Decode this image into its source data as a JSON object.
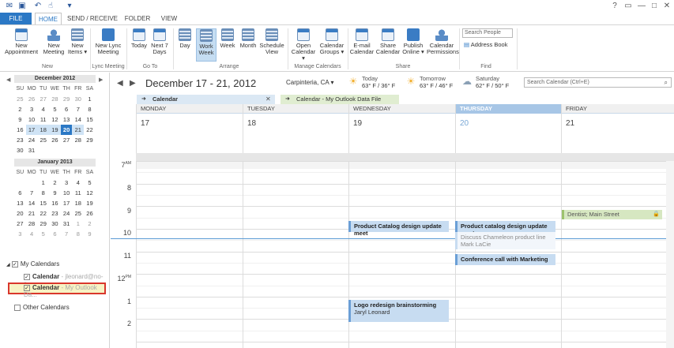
{
  "titlebar": {
    "help": "?",
    "restore": "▭",
    "minimize": "—",
    "maximize": "□",
    "close": "✕"
  },
  "tabs": {
    "file": "FILE",
    "home": "HOME",
    "send_receive": "SEND / RECEIVE",
    "folder": "FOLDER",
    "view": "VIEW"
  },
  "ribbon": {
    "new_appointment": [
      "New",
      "Appointment"
    ],
    "new_meeting": [
      "New",
      "Meeting"
    ],
    "new_items": [
      "New",
      "Items ▾"
    ],
    "new_lync_meeting": [
      "New Lync",
      "Meeting"
    ],
    "today": "Today",
    "next7": [
      "Next 7",
      "Days"
    ],
    "day": "Day",
    "work_week": [
      "Work",
      "Week"
    ],
    "week": "Week",
    "month": "Month",
    "schedule_view": [
      "Schedule",
      "View"
    ],
    "open_calendar": [
      "Open",
      "Calendar ▾"
    ],
    "calendar_groups": [
      "Calendar",
      "Groups ▾"
    ],
    "email_calendar": [
      "E-mail",
      "Calendar"
    ],
    "share_calendar": [
      "Share",
      "Calendar"
    ],
    "publish_online": [
      "Publish",
      "Online ▾"
    ],
    "calendar_permissions": [
      "Calendar",
      "Permissions"
    ],
    "search_people_placeholder": "Search People",
    "address_book": "Address Book",
    "groups": {
      "new": "New",
      "lync": "Lync Meeting",
      "goto": "Go To",
      "arrange": "Arrange",
      "manage": "Manage Calendars",
      "share": "Share",
      "find": "Find"
    }
  },
  "mini_calendars": [
    {
      "title": "December 2012",
      "dow": [
        "SU",
        "MO",
        "TU",
        "WE",
        "TH",
        "FR",
        "SA"
      ],
      "weeks": [
        [
          "25",
          "26",
          "27",
          "28",
          "29",
          "30",
          "1"
        ],
        [
          "2",
          "3",
          "4",
          "5",
          "6",
          "7",
          "8"
        ],
        [
          "9",
          "10",
          "11",
          "12",
          "13",
          "14",
          "15"
        ],
        [
          "16",
          "17",
          "18",
          "19",
          "20",
          "21",
          "22"
        ],
        [
          "23",
          "24",
          "25",
          "26",
          "27",
          "28",
          "29"
        ],
        [
          "30",
          "31",
          "",
          "",
          "",
          "",
          ""
        ]
      ]
    },
    {
      "title": "January 2013",
      "dow": [
        "SU",
        "MO",
        "TU",
        "WE",
        "TH",
        "FR",
        "SA"
      ],
      "weeks": [
        [
          "",
          "",
          "1",
          "2",
          "3",
          "4",
          "5"
        ],
        [
          "6",
          "7",
          "8",
          "9",
          "10",
          "11",
          "12"
        ],
        [
          "13",
          "14",
          "15",
          "16",
          "17",
          "18",
          "19"
        ],
        [
          "20",
          "21",
          "22",
          "23",
          "24",
          "25",
          "26"
        ],
        [
          "27",
          "28",
          "29",
          "30",
          "31",
          "1",
          "2"
        ],
        [
          "3",
          "4",
          "5",
          "6",
          "7",
          "8",
          "9"
        ]
      ]
    }
  ],
  "calendar_tree": {
    "my_calendars": "My Calendars",
    "cal1_name": "Calendar",
    "cal1_account": " - jleonard@no-s...",
    "cal2_name": "Calendar",
    "cal2_account": " - My Outlook Da...",
    "other_calendars": "Other Calendars"
  },
  "header": {
    "date_range": "December 17 - 21, 2012",
    "location": "Carpinteria, CA",
    "weather": [
      {
        "label": "Today",
        "temp": "63° F / 36° F"
      },
      {
        "label": "Tomorrow",
        "temp": "63° F / 46° F"
      },
      {
        "label": "Saturday",
        "temp": "62° F / 50° F"
      }
    ],
    "search_placeholder": "Search Calendar (Ctrl+E)"
  },
  "calendar_tabs": [
    {
      "label": "Calendar"
    },
    {
      "label": "Calendar - My Outlook Data File"
    }
  ],
  "days": [
    {
      "name": "MONDAY",
      "date": "17"
    },
    {
      "name": "TUESDAY",
      "date": "18"
    },
    {
      "name": "WEDNESDAY",
      "date": "19"
    },
    {
      "name": "THURSDAY",
      "date": "20"
    },
    {
      "name": "FRIDAY",
      "date": "21"
    }
  ],
  "hours": [
    {
      "h": "7",
      "suffix": "AM"
    },
    {
      "h": "8",
      "suffix": ""
    },
    {
      "h": "9",
      "suffix": ""
    },
    {
      "h": "10",
      "suffix": ""
    },
    {
      "h": "11",
      "suffix": ""
    },
    {
      "h": "12",
      "suffix": "PM"
    },
    {
      "h": "1",
      "suffix": ""
    },
    {
      "h": "2",
      "suffix": ""
    }
  ],
  "appointments": {
    "dentist": {
      "title": "Dentist; Main Street"
    },
    "wed_catalog": {
      "title": "Product Catalog design update meet"
    },
    "thu_catalog": {
      "title": "Product catalog design update meet"
    },
    "thu_chameleon": {
      "title": "Discuss Chameleon product line",
      "organizer": "Mark LaCie"
    },
    "thu_conference": {
      "title": "Conference call with Marketing"
    },
    "wed_logo": {
      "title": "Logo redesign brainstorming",
      "organizer": "Jaryl Leonard"
    }
  },
  "colors": {
    "accent": "#2b78c5",
    "selected_week": "#cfe3f5",
    "appointment_blue": "#c7dcf1",
    "appointment_green": "#d6e7c1",
    "highlight_border": "#d9372c"
  }
}
